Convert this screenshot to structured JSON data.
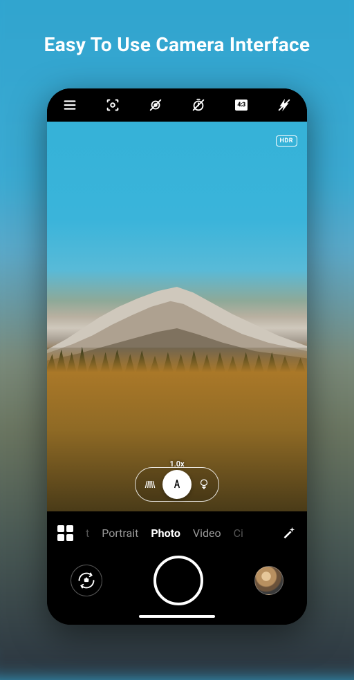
{
  "hero": {
    "title": "Easy To Use Camera Interface"
  },
  "topbar": {
    "aspect": "4:3"
  },
  "viewfinder": {
    "hdr_label": "HDR",
    "zoom_label": "1.0x"
  },
  "modes": {
    "partial_left": "t",
    "items": [
      "Portrait",
      "Photo",
      "Video"
    ],
    "partial_right": "Ci",
    "active_index": 1
  }
}
